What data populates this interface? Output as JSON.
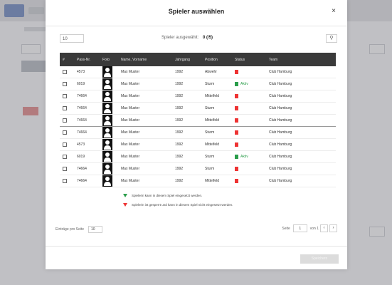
{
  "modal": {
    "title": "Spieler auswählen",
    "close_label": "×",
    "page_size": "10",
    "selected_label": "Spieler ausgewählt:",
    "selected_count": "0 (/5)",
    "search_icon": "⚲",
    "confirm_label": "Speichern"
  },
  "table": {
    "headers": [
      "#",
      "Pass-Nr.",
      "Foto",
      "Name, Vorname",
      "Jahrgang",
      "Position",
      "Status",
      "Team"
    ],
    "rows": [
      {
        "pass": "4573",
        "name": "Max Muster",
        "year": "1992",
        "position": "Abwehr",
        "status": "bad",
        "status_text": "",
        "team": "Club Hamburg"
      },
      {
        "pass": "6019",
        "name": "Max Muster",
        "year": "1992",
        "position": "Sturm",
        "status": "good",
        "status_text": "Aktiv",
        "team": "Club Hamburg"
      },
      {
        "pass": "74664",
        "name": "Max Muster",
        "year": "1992",
        "position": "Mittelfeld",
        "status": "bad",
        "status_text": "",
        "team": "Club Hamburg"
      },
      {
        "pass": "74664",
        "name": "Max Muster",
        "year": "1992",
        "position": "Sturm",
        "status": "bad",
        "status_text": "",
        "team": "Club Hamburg"
      },
      {
        "pass": "74664",
        "name": "Max Muster",
        "year": "1992",
        "position": "Mittelfeld",
        "status": "bad",
        "status_text": "",
        "team": "Club Hamburg"
      },
      {
        "pass": "74664",
        "name": "Max Muster",
        "year": "1992",
        "position": "Sturm",
        "status": "bad",
        "status_text": "",
        "team": "Club Hamburg"
      },
      {
        "pass": "4573",
        "name": "Max Muster",
        "year": "1992",
        "position": "Mittelfeld",
        "status": "bad",
        "status_text": "",
        "team": "Club Hamburg"
      },
      {
        "pass": "6019",
        "name": "Max Muster",
        "year": "1992",
        "position": "Sturm",
        "status": "good",
        "status_text": "Aktiv",
        "team": "Club Hamburg"
      },
      {
        "pass": "74664",
        "name": "Max Muster",
        "year": "1992",
        "position": "Sturm",
        "status": "bad",
        "status_text": "",
        "team": "Club Hamburg"
      },
      {
        "pass": "74664",
        "name": "Max Muster",
        "year": "1992",
        "position": "Mittelfeld",
        "status": "bad",
        "status_text": "",
        "team": "Club Hamburg"
      }
    ]
  },
  "legend": {
    "green": "Spielerin kann in diesem Spiel eingesetzt werden.",
    "red": "Spielerin ist gesperrt und kann in diesem Spiel nicht eingesetzt werden."
  },
  "footer": {
    "entries_label": "Einträge pro Seite",
    "entries_value": "10",
    "page_label": "Seite",
    "page_value": "1",
    "of_label": "von 1",
    "prev_icon": "‹",
    "next_icon": "›"
  },
  "colors": {
    "header_bg": "#3a3a3a",
    "status_bad": "#e33333",
    "status_good": "#2a9d4a"
  }
}
